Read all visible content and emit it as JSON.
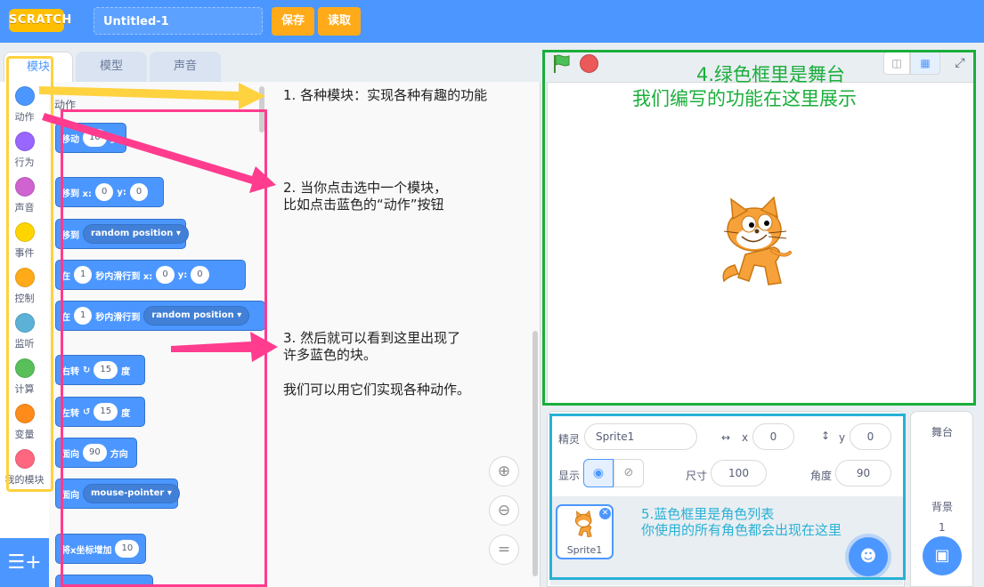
{
  "header": {
    "logo": "SCRATCH",
    "project_title": "Untitled-1",
    "save_label": "保存",
    "load_label": "读取"
  },
  "tabs": [
    {
      "label": "模块",
      "active": true
    },
    {
      "label": "模型",
      "active": false
    },
    {
      "label": "声音",
      "active": false
    }
  ],
  "categories": [
    {
      "label": "动作",
      "color": "#4c97ff"
    },
    {
      "label": "行为",
      "color": "#9966ff"
    },
    {
      "label": "声音",
      "color": "#cf63cf"
    },
    {
      "label": "事件",
      "color": "#ffd500"
    },
    {
      "label": "控制",
      "color": "#ffab19"
    },
    {
      "label": "监听",
      "color": "#5cb1d6"
    },
    {
      "label": "计算",
      "color": "#59c059"
    },
    {
      "label": "变量",
      "color": "#ff8c1a"
    },
    {
      "label": "我的模块",
      "color": "#ff6680"
    }
  ],
  "palette": {
    "heading": "动作",
    "blocks": {
      "move": {
        "label": "移动",
        "value": "10",
        "suffix": "步"
      },
      "goto_xy": {
        "label": "移到 x:",
        "x": "0",
        "ylabel": "y:",
        "y": "0"
      },
      "goto": {
        "label": "移到",
        "target": "random position"
      },
      "glide_xy": {
        "prefix": "在",
        "secs": "1",
        "label": "秒内滑行到 x:",
        "x": "0",
        "ylabel": "y:",
        "y": "0"
      },
      "glide_to": {
        "prefix": "在",
        "secs": "1",
        "label": "秒内滑行到",
        "target": "random position"
      },
      "turn_right": {
        "label": "右转",
        "value": "15",
        "suffix": "度"
      },
      "turn_left": {
        "label": "左转",
        "value": "15",
        "suffix": "度"
      },
      "point_dir": {
        "label": "面向",
        "value": "90",
        "suffix": "方向"
      },
      "point_toward": {
        "label": "面向",
        "target": "mouse-pointer"
      },
      "change_x": {
        "label": "将x坐标增加",
        "value": "10"
      }
    }
  },
  "annotations": {
    "note1": "1. 各种模块：实现各种有趣的功能",
    "note2_line1": "2. 当你点击选中一个模块，",
    "note2_line2": "比如点击蓝色的“动作”按钮",
    "note3_line1": "3. 然后就可以看到这里出现了",
    "note3_line2": "许多蓝色的块。",
    "note3_line3": "我们可以用它们实现各种动作。",
    "stage_line1": "4.绿色框里是舞台",
    "stage_line2": "我们编写的功能在这里展示",
    "sprites_line1": "5.蓝色框里是角色列表",
    "sprites_line2": "你使用的所有角色都会出现在这里",
    "yellow": "#ffd23f",
    "pink": "#ff3c8e",
    "green": "#1aae3b",
    "blue": "#29b0d6"
  },
  "sprite_info": {
    "sprite_label": "精灵",
    "sprite_name": "Sprite1",
    "x_label": "x",
    "x_value": "0",
    "y_label": "y",
    "y_value": "0",
    "show_label": "显示",
    "size_label": "尺寸",
    "size_value": "100",
    "direction_label": "角度",
    "direction_value": "90"
  },
  "sprites": [
    {
      "name": "Sprite1"
    }
  ],
  "stage_pane": {
    "title": "舞台",
    "backdrops_label": "背景",
    "backdrops_count": "1"
  }
}
